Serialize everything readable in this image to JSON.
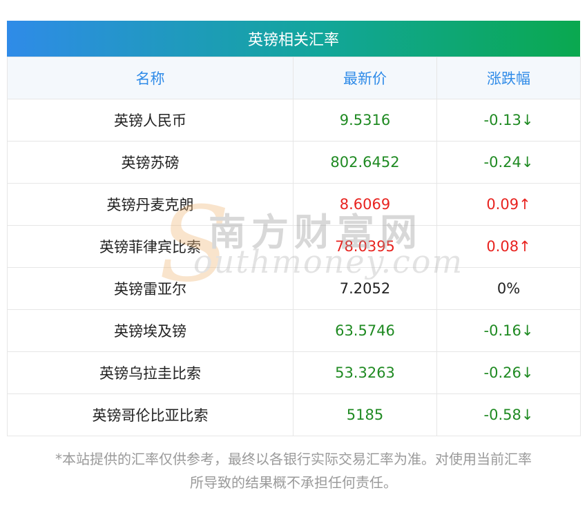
{
  "title": "英镑相关汇率",
  "headers": {
    "name": "名称",
    "price": "最新价",
    "change": "涨跌幅"
  },
  "rows": [
    {
      "name": "英镑人民币",
      "price": "9.5316",
      "change": "-0.13↓",
      "trend": "down"
    },
    {
      "name": "英镑苏磅",
      "price": "802.6452",
      "change": "-0.24↓",
      "trend": "down"
    },
    {
      "name": "英镑丹麦克朗",
      "price": "8.6069",
      "change": "0.09↑",
      "trend": "up"
    },
    {
      "name": "英镑菲律宾比索",
      "price": "78.0395",
      "change": "0.08↑",
      "trend": "up"
    },
    {
      "name": "英镑雷亚尔",
      "price": "7.2052",
      "change": "0%",
      "trend": "flat"
    },
    {
      "name": "英镑埃及镑",
      "price": "63.5746",
      "change": "-0.16↓",
      "trend": "down"
    },
    {
      "name": "英镑乌拉圭比索",
      "price": "53.3263",
      "change": "-0.26↓",
      "trend": "down"
    },
    {
      "name": "英镑哥伦比亚比索",
      "price": "5185",
      "change": "-0.58↓",
      "trend": "down"
    }
  ],
  "watermark": {
    "letter": "S",
    "cn": "南方财富网",
    "en": "outhmoney.com"
  },
  "disclaimer": {
    "line1": "*本站提供的汇率仅供参考，最终以各银行实际交易汇率为准。对使用当前汇率",
    "line2": "所导致的结果概不承担任何责任。"
  },
  "colors": {
    "up": "#e8231f",
    "down": "#1f8a22",
    "header_text": "#2f8be8"
  }
}
